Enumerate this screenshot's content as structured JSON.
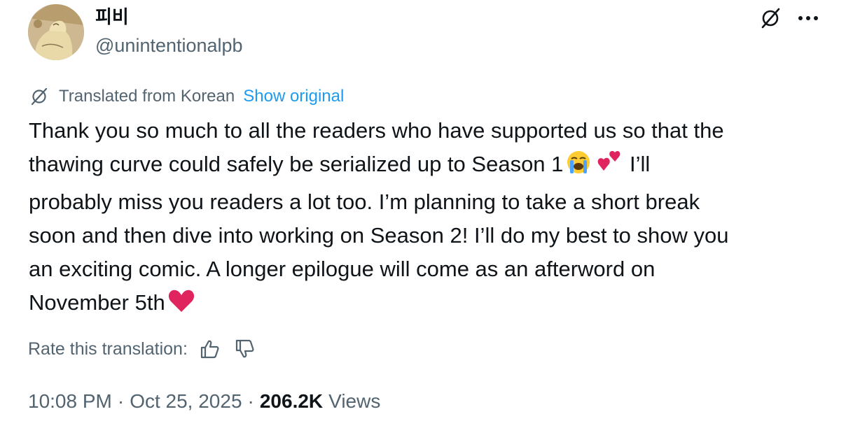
{
  "author": {
    "display_name": "피비",
    "handle": "@unintentionalpb"
  },
  "translation": {
    "notice": "Translated from Korean",
    "show_original_label": "Show original"
  },
  "tweet": {
    "text_part1": "Thank you so much to all the readers who have supported us so that the\nthawing curve could safely be serialized up to Season 1",
    "text_part2": " I’ll\nprobably miss you readers a lot too. I’m planning to take a short break\nsoon and then dive into working on Season 2! I’ll do my best to show you\nan exciting comic. A longer epilogue will come as an afterword on\nNovember 5th",
    "emojis": [
      "crying-face",
      "two-hearts",
      "red-heart"
    ]
  },
  "rating": {
    "label": "Rate this translation:"
  },
  "meta": {
    "time": "10:08 PM",
    "separator": "·",
    "date": "Oct 25, 2025",
    "views_count": "206.2K",
    "views_label": "Views"
  },
  "colors": {
    "text_primary": "#0f1419",
    "text_secondary": "#536471",
    "accent": "#1d9bf0",
    "heart": "#e0245e"
  }
}
